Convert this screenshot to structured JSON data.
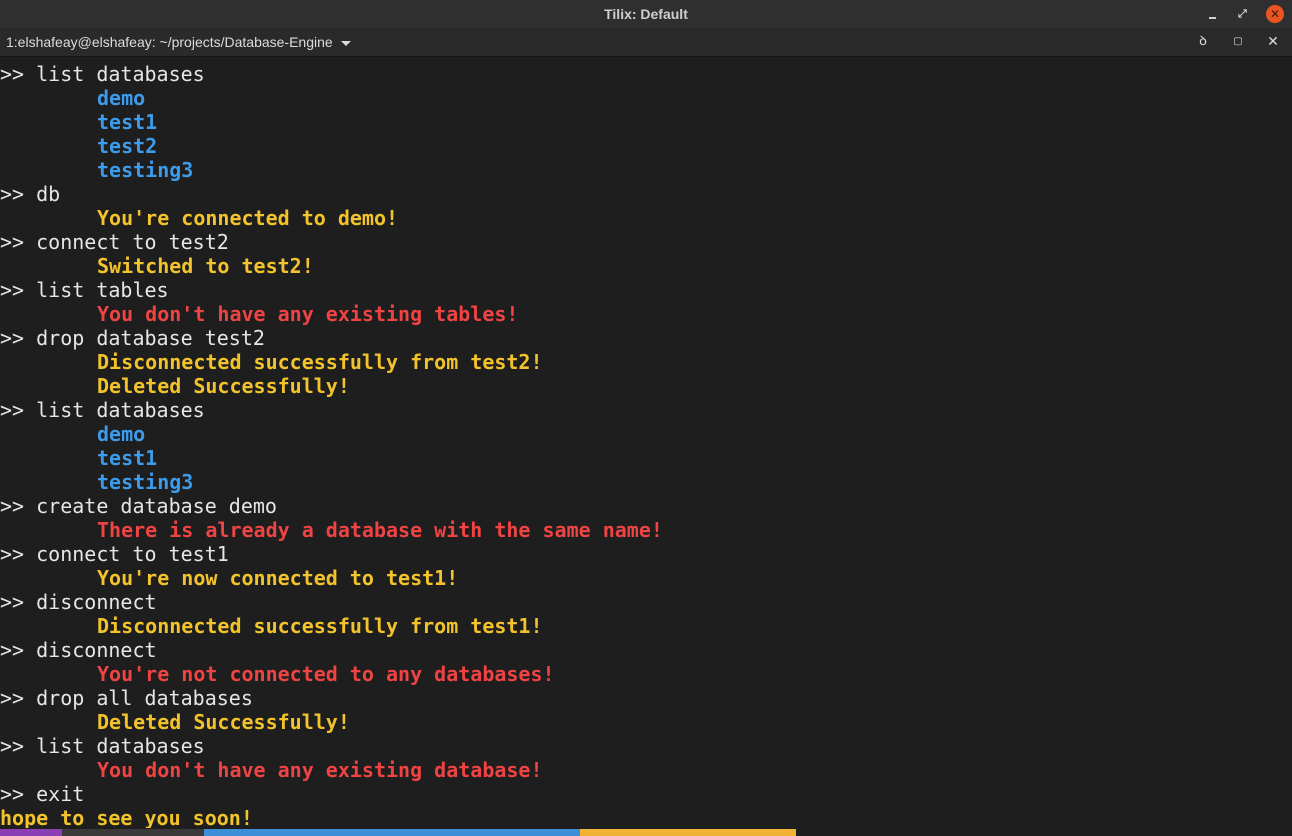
{
  "window": {
    "title": "Tilix: Default",
    "session_title": "1:elshafeay@elshafeay: ~/projects/Database-Engine"
  },
  "colors": {
    "titlebar_bg": "#2f2f2f",
    "terminal_bg": "#1e1e1e",
    "command_text": "#e6e6e6",
    "output_blue": "#3d9be9",
    "output_yellow": "#f2c32a",
    "output_red": "#f04343",
    "close_button": "#e95420"
  },
  "icons": {
    "minimize": "minimize-icon",
    "maximize": "maximize-icon",
    "close": "close-icon",
    "session_menu": "chevron-down-icon",
    "sync_input": "sync-input-icon"
  },
  "terminal": {
    "prompt": ">>",
    "lines": [
      {
        "kind": "cmd",
        "text": "list databases"
      },
      {
        "kind": "blue",
        "text": "demo"
      },
      {
        "kind": "blue",
        "text": "test1"
      },
      {
        "kind": "blue",
        "text": "test2"
      },
      {
        "kind": "blue",
        "text": "testing3"
      },
      {
        "kind": "cmd",
        "text": "db"
      },
      {
        "kind": "yellow",
        "text": "You're connected to demo!"
      },
      {
        "kind": "cmd",
        "text": "connect to test2"
      },
      {
        "kind": "yellow",
        "text": "Switched to test2!"
      },
      {
        "kind": "cmd",
        "text": "list tables"
      },
      {
        "kind": "red",
        "text": "You don't have any existing tables!"
      },
      {
        "kind": "cmd",
        "text": "drop database test2"
      },
      {
        "kind": "yellow",
        "text": "Disconnected successfully from test2!"
      },
      {
        "kind": "yellow",
        "text": "Deleted Successfully!"
      },
      {
        "kind": "cmd",
        "text": "list databases"
      },
      {
        "kind": "blue",
        "text": "demo"
      },
      {
        "kind": "blue",
        "text": "test1"
      },
      {
        "kind": "blue",
        "text": "testing3"
      },
      {
        "kind": "cmd",
        "text": "create database demo"
      },
      {
        "kind": "red",
        "text": "There is already a database with the same name!"
      },
      {
        "kind": "cmd",
        "text": "connect to test1"
      },
      {
        "kind": "yellow",
        "text": "You're now connected to test1!"
      },
      {
        "kind": "cmd",
        "text": "disconnect"
      },
      {
        "kind": "yellow",
        "text": "Disconnected successfully from test1!"
      },
      {
        "kind": "cmd",
        "text": "disconnect"
      },
      {
        "kind": "red",
        "text": "You're not connected to any databases!"
      },
      {
        "kind": "cmd",
        "text": "drop all databases"
      },
      {
        "kind": "yellow",
        "text": "Deleted Successfully!"
      },
      {
        "kind": "cmd",
        "text": "list databases"
      },
      {
        "kind": "red",
        "text": "You don't have any existing database!"
      },
      {
        "kind": "cmd",
        "text": "exit"
      }
    ],
    "final_message": "hope to see you soon!"
  }
}
